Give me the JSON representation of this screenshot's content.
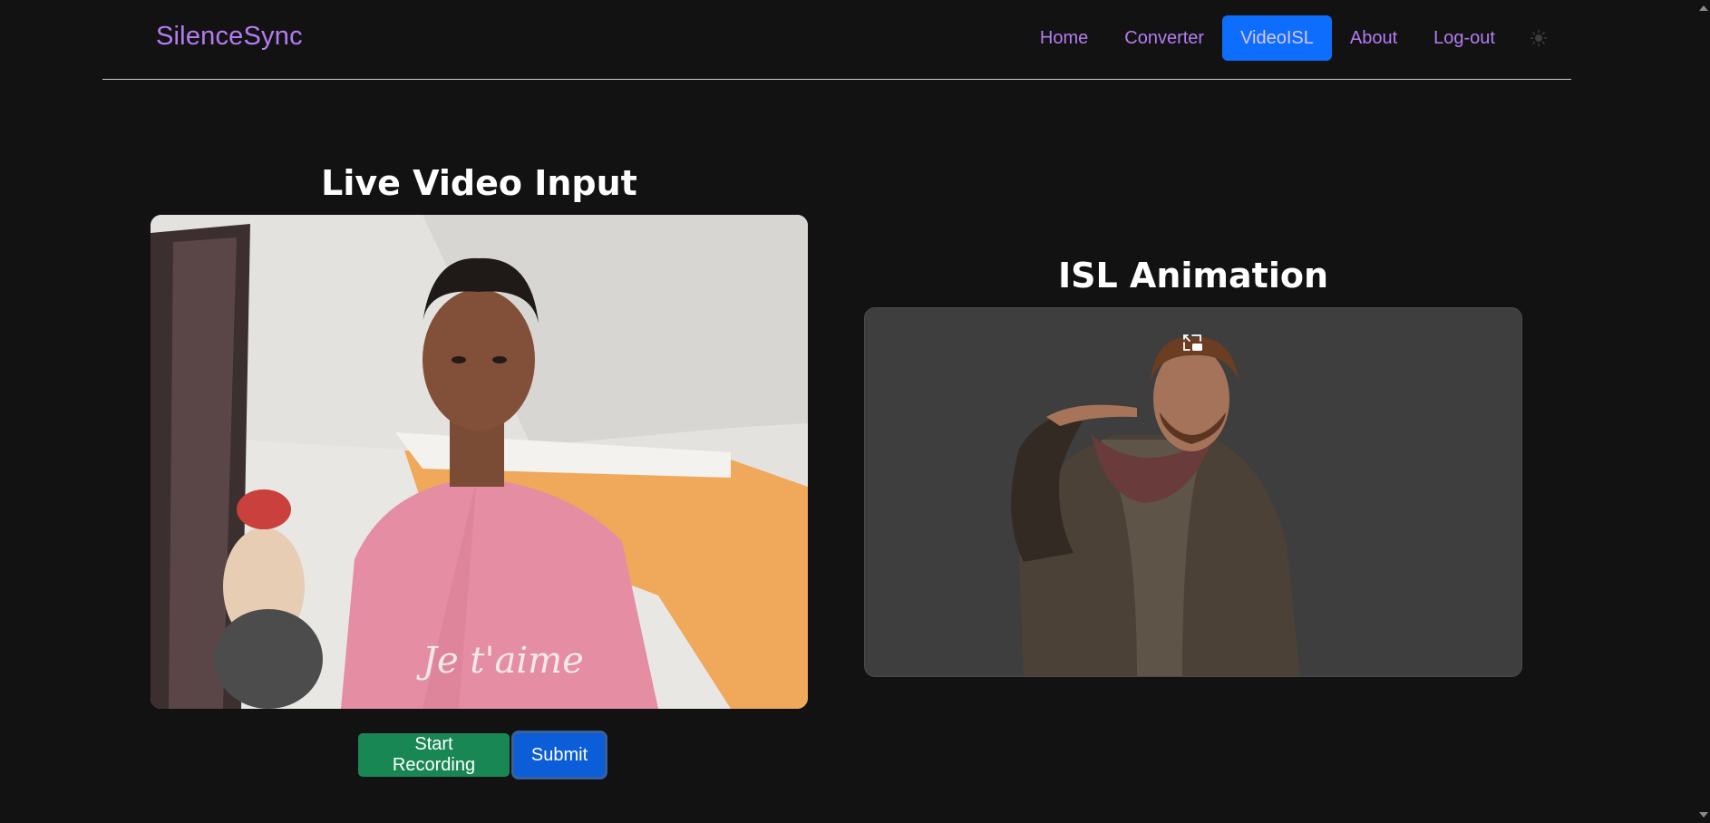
{
  "navbar": {
    "brand": "SilenceSync",
    "links": [
      {
        "label": "Home",
        "active": false
      },
      {
        "label": "Converter",
        "active": false
      },
      {
        "label": "VideoISL",
        "active": true
      },
      {
        "label": "About",
        "active": false
      },
      {
        "label": "Log-out",
        "active": false
      }
    ],
    "theme_icon": "sun-icon"
  },
  "live": {
    "title": "Live Video Input",
    "feed_description": "webcam-feed"
  },
  "isl": {
    "title": "ISL Animation",
    "pip_icon": "picture-in-picture-icon"
  },
  "actions": {
    "start_label": "Start Recording",
    "submit_label": "Submit"
  },
  "colors": {
    "brand": "#b57cf2",
    "active_nav": "#0d6efd",
    "start_button": "#198754",
    "submit_button": "#0b5ed7",
    "background": "#121212"
  }
}
